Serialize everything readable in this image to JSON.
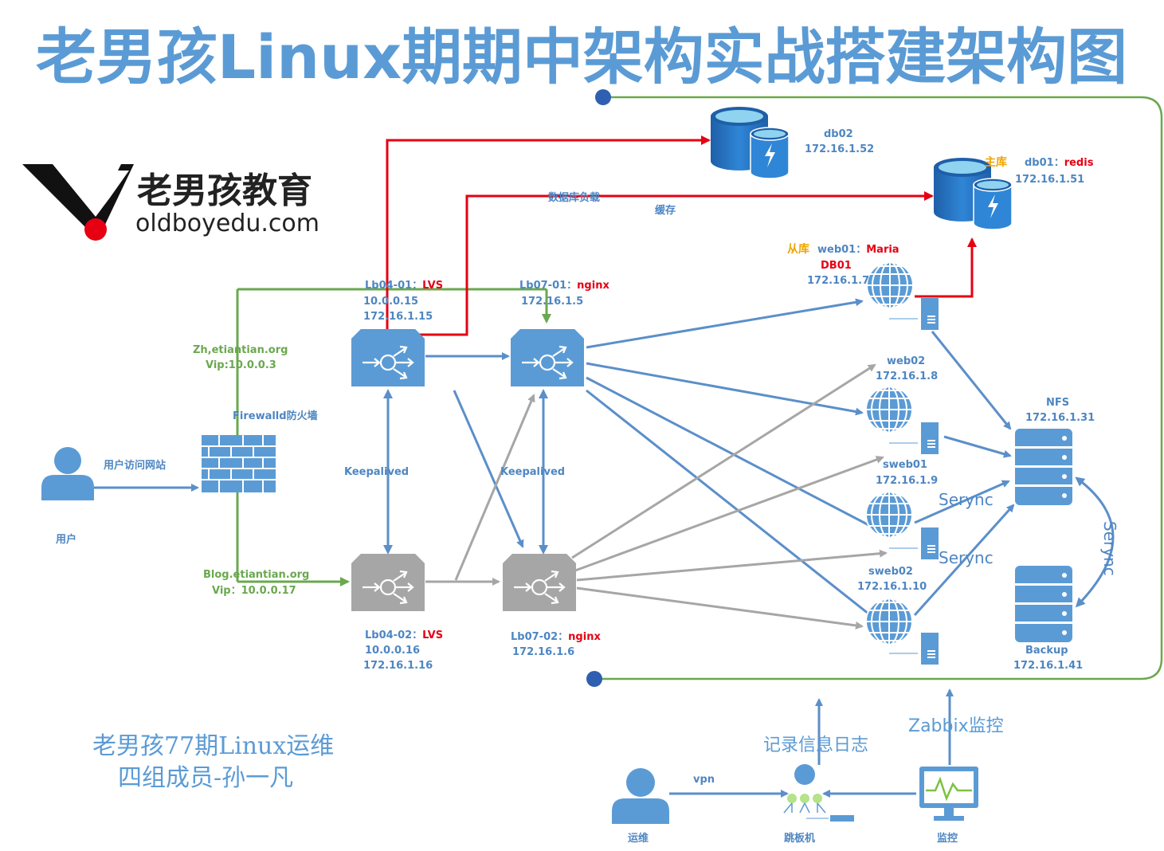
{
  "title": "老男孩Linux期期中架构实战搭建架构图",
  "logo": {
    "brand": "老男孩教育",
    "domain": "oldboyedu.com"
  },
  "user": {
    "label": "用户",
    "action": "用户访问网站"
  },
  "firewall": {
    "label": "Firewalld防火墙"
  },
  "domains": {
    "zh": {
      "name": "Zh,etiantian.org",
      "vip": "Vip:10.0.0.3"
    },
    "blog": {
      "name": "Blog.etiantian.org",
      "vip": "Vip：10.0.0.17"
    }
  },
  "lb04_01": {
    "name": "Lb04-01：",
    "role": "LVS",
    "ip1": "10.0.0.15",
    "ip2": "172.16.1.15"
  },
  "lb04_02": {
    "name": "Lb04-02：",
    "role": "LVS",
    "ip1": "10.0.0.16",
    "ip2": "172.16.1.16"
  },
  "lb07_01": {
    "name": "Lb07-01：",
    "role": "nginx",
    "ip": "172.16.1.5"
  },
  "lb07_02": {
    "name": "Lb07-02：",
    "role": "nginx",
    "ip": "172.16.1.6"
  },
  "keepalived": "Keepalived",
  "db02": {
    "name": "db02",
    "ip": "172.16.1.52"
  },
  "db01": {
    "tag": "主库",
    "name": "db01：",
    "role": "redis",
    "ip": "172.16.1.51"
  },
  "db_load_label": "数据库负载",
  "cache_label": "缓存",
  "web01": {
    "tag": "从库",
    "name": "web01：",
    "role": "Maria",
    "role2": "DB01",
    "ip": "172.16.1.7"
  },
  "web02": {
    "name": "web02",
    "ip": "172.16.1.8"
  },
  "sweb01": {
    "name": "sweb01",
    "ip": "172.16.1.9"
  },
  "sweb02": {
    "name": "sweb02",
    "ip": "172.16.1.10"
  },
  "nfs": {
    "name": "NFS",
    "ip": "172.16.1.31"
  },
  "backup": {
    "name": "Backup",
    "ip": "172.16.1.41"
  },
  "serync": "Serync",
  "credits": {
    "line1": "老男孩77期Linux运维",
    "line2": "四组成员-孙一凡"
  },
  "ops": {
    "admin": "运维",
    "vpn": "vpn",
    "jump": "跳板机",
    "log": "记录信息日志",
    "monitor": "监控",
    "zabbix": "Zabbix监控"
  },
  "colors": {
    "blue": "#4e86c2",
    "icon": "#5b9bd5",
    "gray": "#a6a6a6",
    "red": "#e60012",
    "green": "#6aa84f",
    "orange": "#f0a500"
  }
}
